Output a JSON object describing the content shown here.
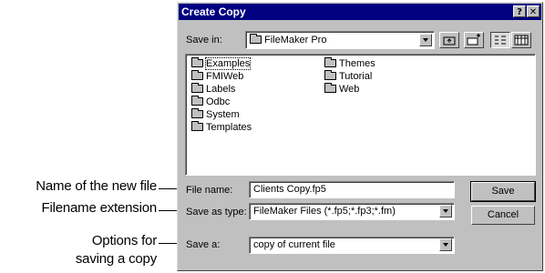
{
  "callouts": {
    "name": "Name of the new file",
    "extension": "Filename extension",
    "options_line1": "Options for",
    "options_line2": "saving a copy"
  },
  "dialog": {
    "title": "Create Copy",
    "help_button": "?",
    "close_button": "✕",
    "save_in_label": "Save in:",
    "save_in_accel": "i",
    "save_in_value": "FileMaker Pro",
    "folders_col1": [
      "Examples",
      "FMIWeb",
      "Labels",
      "Odbc",
      "System",
      "Templates"
    ],
    "folders_col2": [
      "Themes",
      "Tutorial",
      "Web"
    ],
    "file_name_label": "File name:",
    "file_name_value": "Clients Copy.fp5",
    "save_as_type_label": "Save as type:",
    "save_as_type_value": "FileMaker Files (*.fp5;*.fp3;*.fm)",
    "save_a_label": "Save a:",
    "save_a_value": "copy of current file",
    "save_button": "Save",
    "cancel_button": "Cancel"
  }
}
